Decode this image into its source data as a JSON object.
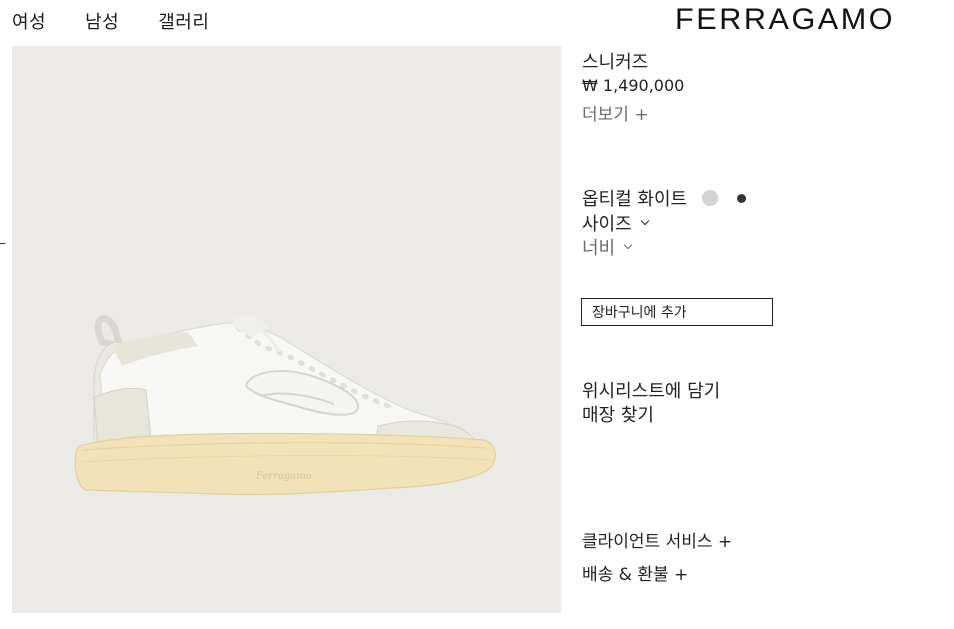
{
  "nav": {
    "items": [
      "여성",
      "남성",
      "갤러리"
    ]
  },
  "brand": {
    "logo_text": "FERRAGAMO"
  },
  "hero": {
    "sole_script": "Ferragamo"
  },
  "product": {
    "name": "스니커즈",
    "price": "₩ 1,490,000",
    "more_label": "더보기 +",
    "color_name": "옵티컬 화이트",
    "swatches": [
      {
        "color": "#d4d4d4",
        "icon": "swatch-light-gray"
      },
      {
        "color": "#333333",
        "icon": "swatch-black"
      }
    ],
    "size_label": "사이즈",
    "width_label": "너비",
    "add_to_cart": "장바구니에 추가",
    "wishlist": "위시리스트에 담기",
    "find_store": "매장 찾기",
    "client_service": "클라이언트 서비스 +",
    "shipping": "배송 & 환불 +"
  },
  "colors": {
    "hero_bg": "#ebeae6",
    "sole": "#f1e2b8",
    "upper": "#f8f8f6",
    "suede": "#e6e4d8"
  }
}
